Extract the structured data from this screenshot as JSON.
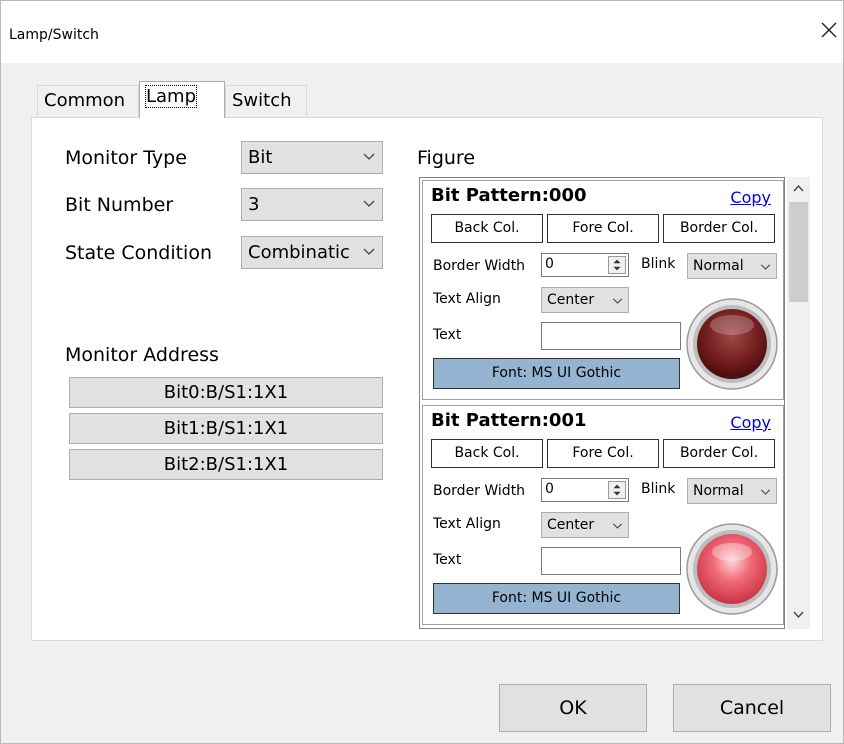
{
  "window": {
    "title": "Lamp/Switch"
  },
  "tabs": [
    {
      "label": "Common"
    },
    {
      "label": "Lamp"
    },
    {
      "label": "Switch"
    }
  ],
  "lamp": {
    "monitor_type": {
      "label": "Monitor Type",
      "value": "Bit"
    },
    "bit_number": {
      "label": "Bit Number",
      "value": "3"
    },
    "state_condition": {
      "label": "State Condition",
      "value": "Combinatic"
    },
    "monitor_address": {
      "label": "Monitor Address",
      "items": [
        "Bit0:B/S1:1X1",
        "Bit1:B/S1:1X1",
        "Bit2:B/S1:1X1"
      ]
    },
    "figure": {
      "label": "Figure",
      "patterns": [
        {
          "title": "Bit Pattern:000",
          "copy": "Copy",
          "back_col": "Back Col.",
          "fore_col": "Fore Col.",
          "border_col": "Border Col.",
          "border_width_label": "Border Width",
          "border_width_value": "0",
          "blink_label": "Blink",
          "blink_value": "Normal",
          "text_align_label": "Text Align",
          "text_align_value": "Center",
          "text_label": "Text",
          "text_value": "",
          "font": "Font: MS UI Gothic",
          "lamp_color": "#7a1f1f"
        },
        {
          "title": "Bit Pattern:001",
          "copy": "Copy",
          "back_col": "Back Col.",
          "fore_col": "Fore Col.",
          "border_col": "Border Col.",
          "border_width_label": "Border Width",
          "border_width_value": "0",
          "blink_label": "Blink",
          "blink_value": "Normal",
          "text_align_label": "Text Align",
          "text_align_value": "Center",
          "text_label": "Text",
          "text_value": "",
          "font": "Font: MS UI Gothic",
          "lamp_color": "#e85a6a"
        }
      ]
    }
  },
  "buttons": {
    "ok": "OK",
    "cancel": "Cancel"
  },
  "icons": {
    "close": "close-icon",
    "chevron": "chevron-down-icon",
    "spin": "spin-updown-icon",
    "scroll_up": "scroll-up-icon",
    "scroll_down": "scroll-down-icon"
  }
}
